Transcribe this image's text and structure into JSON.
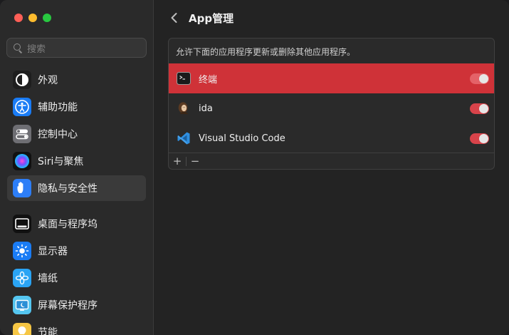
{
  "window": {
    "title": "App管理"
  },
  "sidebar": {
    "search_placeholder": "搜索",
    "items": [
      {
        "label": "外观",
        "icon": "appearance-icon"
      },
      {
        "label": "辅助功能",
        "icon": "accessibility-icon"
      },
      {
        "label": "控制中心",
        "icon": "control-center-icon"
      },
      {
        "label": "Siri与聚焦",
        "icon": "siri-icon"
      },
      {
        "label": "隐私与安全性",
        "icon": "hand-icon",
        "selected": true
      },
      {
        "label": "桌面与程序坞",
        "icon": "dock-icon"
      },
      {
        "label": "显示器",
        "icon": "display-icon"
      },
      {
        "label": "墙纸",
        "icon": "wallpaper-icon"
      },
      {
        "label": "屏幕保护程序",
        "icon": "screensaver-icon"
      },
      {
        "label": "节能",
        "icon": "energy-icon"
      }
    ]
  },
  "panel": {
    "description": "允许下面的应用程序更新或删除其他应用程序。",
    "apps": [
      {
        "name": "终端",
        "icon": "terminal-icon",
        "enabled": true,
        "selected": true
      },
      {
        "name": "ida",
        "icon": "ida-icon",
        "enabled": true,
        "selected": false
      },
      {
        "name": "Visual Studio Code",
        "icon": "vscode-icon",
        "enabled": true,
        "selected": false
      }
    ],
    "add_label": "+",
    "remove_label": "−"
  },
  "colors": {
    "accent_red": "#cf3238",
    "toggle_on": "#d8434a",
    "sidebar_bg": "#2a2a2a",
    "window_bg": "#232323"
  }
}
